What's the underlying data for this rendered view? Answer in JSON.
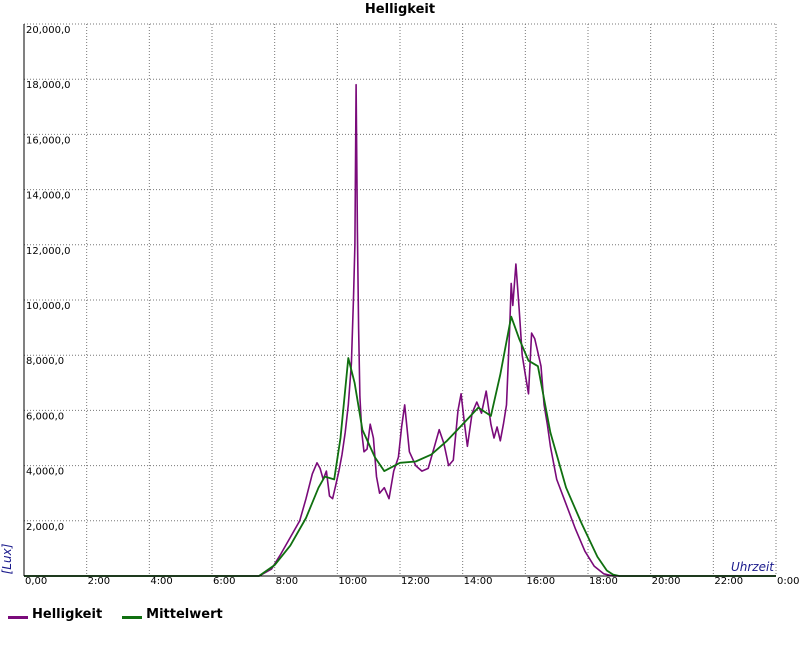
{
  "chart_data": {
    "type": "line",
    "title": "Helligkeit",
    "xlabel": "Uhrzeit",
    "ylabel": "[Lux]",
    "xlim": [
      0,
      24
    ],
    "ylim": [
      0,
      20000
    ],
    "grid": true,
    "legend_position": "bottom-left",
    "x_ticks": [
      "0,00",
      "2:00",
      "4:00",
      "6:00",
      "8:00",
      "10:00",
      "12:00",
      "14:00",
      "16:00",
      "18:00",
      "20:00",
      "22:00",
      "0:00"
    ],
    "y_ticks": [
      "2,000,0",
      "4,000,0",
      "6,000,0",
      "8,000,0",
      "10,000,0",
      "12,000,0",
      "14,000,0",
      "16,000,0",
      "18,000,0",
      "20,000,0"
    ],
    "series": [
      {
        "name": "Helligkeit",
        "color": "#7a0a7a",
        "x": [
          0,
          7.5,
          7.9,
          8.2,
          8.5,
          8.8,
          9.0,
          9.2,
          9.35,
          9.45,
          9.55,
          9.65,
          9.75,
          9.85,
          9.95,
          10.05,
          10.15,
          10.25,
          10.35,
          10.45,
          10.52,
          10.56,
          10.6,
          10.64,
          10.68,
          10.72,
          10.78,
          10.85,
          10.95,
          11.05,
          11.15,
          11.25,
          11.35,
          11.5,
          11.65,
          11.8,
          11.95,
          12.05,
          12.15,
          12.3,
          12.5,
          12.7,
          12.9,
          13.1,
          13.25,
          13.4,
          13.55,
          13.7,
          13.85,
          13.95,
          14.05,
          14.15,
          14.3,
          14.45,
          14.6,
          14.75,
          14.9,
          15.0,
          15.1,
          15.2,
          15.3,
          15.4,
          15.5,
          15.55,
          15.6,
          15.7,
          15.8,
          15.9,
          16.0,
          16.1,
          16.2,
          16.3,
          16.4,
          16.5,
          16.6,
          16.7,
          16.8,
          17.0,
          17.3,
          17.6,
          17.9,
          18.2,
          18.5,
          18.8,
          19.0,
          24
        ],
        "y": [
          0,
          0,
          250,
          800,
          1400,
          2000,
          2800,
          3700,
          4100,
          3900,
          3500,
          3800,
          2900,
          2800,
          3300,
          3800,
          4400,
          5200,
          6200,
          7700,
          10200,
          12000,
          17800,
          12500,
          9000,
          6500,
          5200,
          4500,
          4600,
          5500,
          5000,
          3600,
          3000,
          3200,
          2800,
          3800,
          4300,
          5400,
          6200,
          4500,
          4000,
          3800,
          3900,
          4700,
          5300,
          4800,
          4000,
          4200,
          6000,
          6600,
          5600,
          4700,
          5900,
          6300,
          5900,
          6700,
          5500,
          5000,
          5400,
          4900,
          5500,
          6200,
          9000,
          10600,
          9800,
          11300,
          9700,
          8000,
          7300,
          6600,
          8800,
          8600,
          8100,
          7600,
          6200,
          5500,
          4700,
          3500,
          2600,
          1700,
          900,
          350,
          80,
          0,
          0,
          0
        ]
      },
      {
        "name": "Mittelwert",
        "color": "#107010",
        "x": [
          0,
          7.5,
          8.0,
          8.5,
          9.0,
          9.4,
          9.6,
          9.9,
          10.1,
          10.35,
          10.55,
          10.8,
          11.2,
          11.5,
          12.0,
          12.5,
          13.0,
          13.5,
          14.0,
          14.5,
          14.9,
          15.2,
          15.55,
          15.8,
          16.1,
          16.4,
          16.8,
          17.3,
          17.8,
          18.3,
          18.6,
          18.8,
          19.0,
          24
        ],
        "y": [
          0,
          0,
          400,
          1100,
          2100,
          3200,
          3600,
          3500,
          5000,
          7900,
          7000,
          5300,
          4300,
          3800,
          4100,
          4150,
          4400,
          4900,
          5500,
          6100,
          5800,
          7300,
          9400,
          8600,
          7800,
          7600,
          5200,
          3200,
          1900,
          700,
          200,
          50,
          0,
          0
        ]
      }
    ]
  }
}
